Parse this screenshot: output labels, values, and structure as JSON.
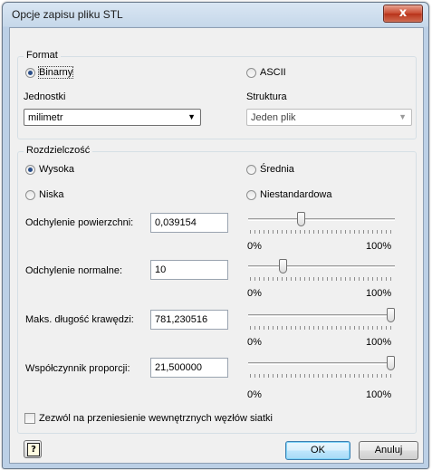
{
  "window": {
    "title": "Opcje zapisu pliku STL",
    "close_glyph": "x"
  },
  "format": {
    "group_title": "Format",
    "binary_label": "Binarny",
    "binary_selected": true,
    "ascii_label": "ASCII",
    "ascii_selected": false,
    "units_label": "Jednostki",
    "units_value": "milimetr",
    "structure_label": "Struktura",
    "structure_value": "Jeden plik"
  },
  "resolution": {
    "group_title": "Rozdzielczość",
    "options": [
      {
        "label": "Wysoka",
        "selected": true
      },
      {
        "label": "Średnia",
        "selected": false
      },
      {
        "label": "Niska",
        "selected": false
      },
      {
        "label": "Niestandardowa",
        "selected": false
      }
    ],
    "params": [
      {
        "label": "Odchylenie powierzchni:",
        "value": "0,039154",
        "slider_fraction": 0.35,
        "min_label": "0%",
        "max_label": "100%"
      },
      {
        "label": "Odchylenie normalne:",
        "value": "10",
        "slider_fraction": 0.22,
        "min_label": "0%",
        "max_label": "100%"
      },
      {
        "label": "Maks. długość krawędzi:",
        "value": "781,230516",
        "slider_fraction": 1.0,
        "min_label": "0%",
        "max_label": "100%"
      },
      {
        "label": "Współczynnik proporcji:",
        "value": "21,500000",
        "slider_fraction": 1.0,
        "min_label": "0%",
        "max_label": "100%"
      }
    ],
    "allow_move_label": "Zezwól na przeniesienie wewnętrznych węzłów siatki",
    "allow_move_checked": false
  },
  "buttons": {
    "help_glyph": "?",
    "ok_label": "OK",
    "cancel_label": "Anuluj"
  },
  "colors": {
    "accent": "#3c7fb1",
    "close_red": "#c8492f",
    "title_bar": "#c6d8ea"
  }
}
